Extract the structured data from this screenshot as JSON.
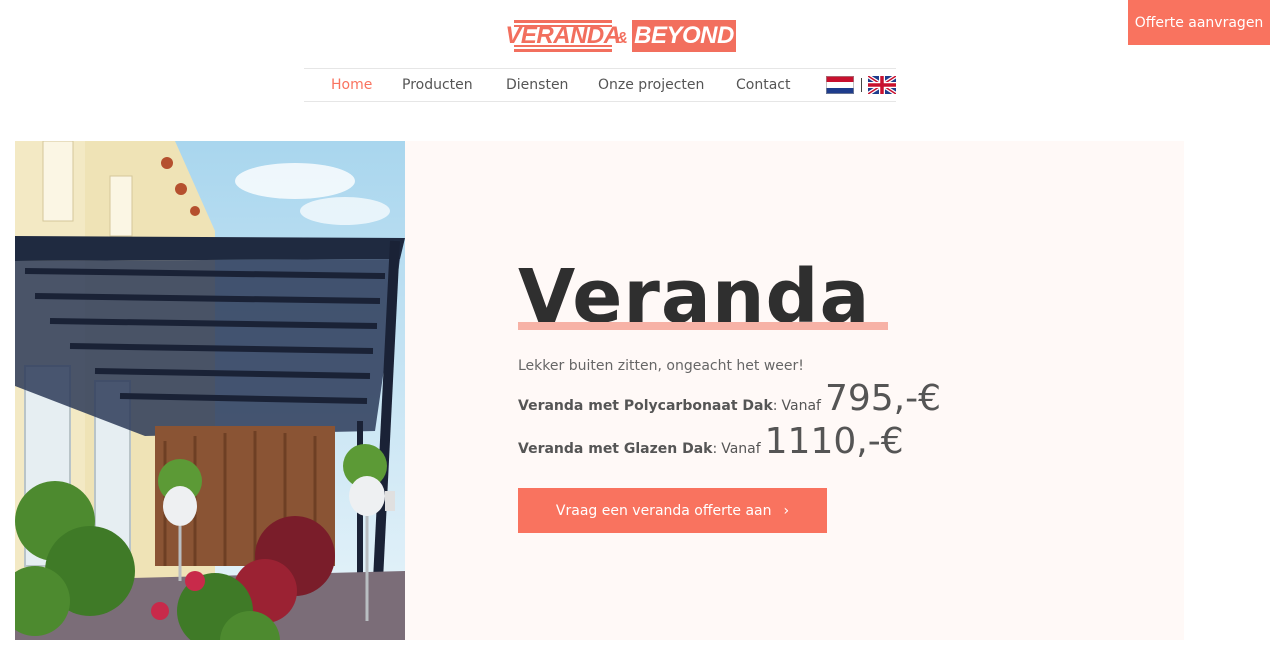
{
  "header": {
    "logo": {
      "left_text": "VERANDA",
      "amp": "&",
      "right_text": "BEYOND"
    },
    "quote_button": "Offerte aanvragen"
  },
  "nav": {
    "items": [
      {
        "label": "Home",
        "active": true
      },
      {
        "label": "Producten",
        "active": false
      },
      {
        "label": "Diensten",
        "active": false
      },
      {
        "label": "Onze projecten",
        "active": false
      },
      {
        "label": "Contact",
        "active": false
      }
    ],
    "languages": [
      {
        "icon": "netherlands-flag-icon"
      },
      {
        "icon": "uk-flag-icon"
      }
    ]
  },
  "hero": {
    "title": "Veranda",
    "tagline": "Lekker buiten zitten, ongeacht het weer!",
    "prices": [
      {
        "name": "Veranda met Polycarbonaat Dak",
        "separator": ":",
        "prefix": "Vanaf",
        "amount": "795,-€"
      },
      {
        "name": "Veranda met Glazen Dak",
        "separator": ":",
        "prefix": "Vanaf",
        "amount": "1110,-€"
      }
    ],
    "cta": {
      "label": "Vraag een veranda offerte aan",
      "icon": "chevron-right-icon"
    }
  },
  "colors": {
    "accent": "#f9735f",
    "title_underline": "#f7b2a6",
    "hero_background": "#fff9f7"
  }
}
